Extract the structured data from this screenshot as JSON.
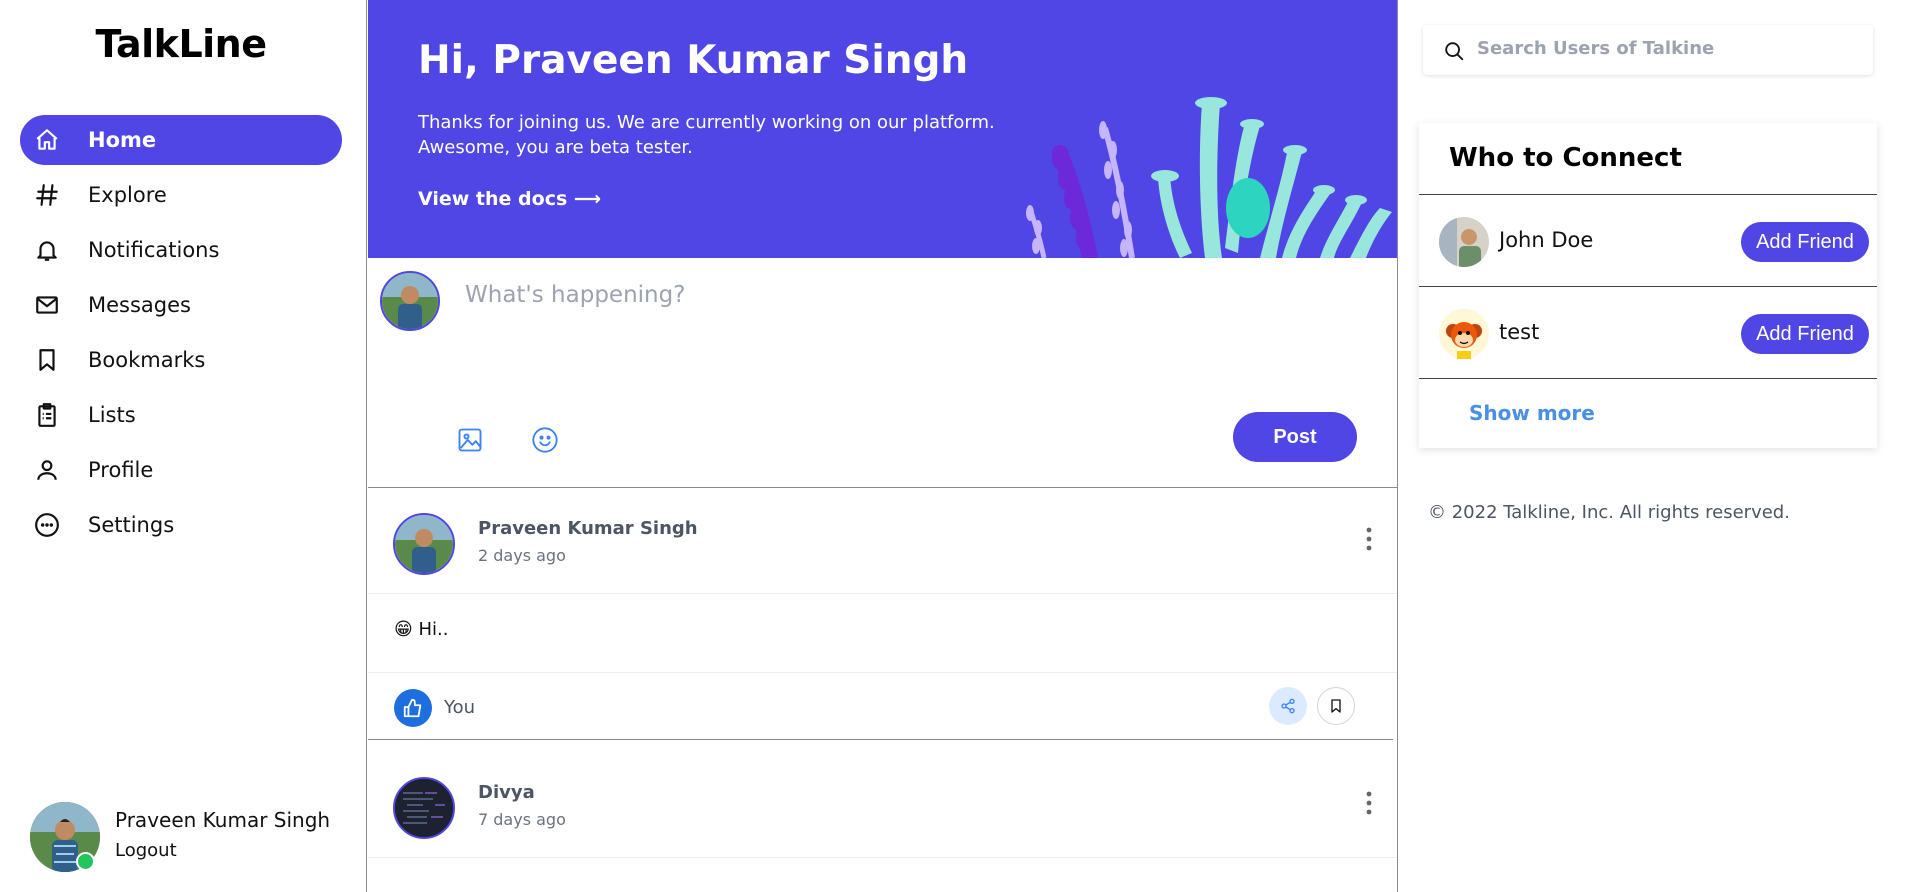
{
  "app": {
    "name": "TalkLine"
  },
  "sidebar": {
    "items": [
      {
        "label": "Home",
        "icon": "home-icon",
        "active": true
      },
      {
        "label": "Explore",
        "icon": "hashtag-icon"
      },
      {
        "label": "Notifications",
        "icon": "bell-icon"
      },
      {
        "label": "Messages",
        "icon": "mail-icon"
      },
      {
        "label": "Bookmarks",
        "icon": "bookmark-icon"
      },
      {
        "label": "Lists",
        "icon": "clipboard-list-icon"
      },
      {
        "label": "Profile",
        "icon": "user-icon"
      },
      {
        "label": "Settings",
        "icon": "more-circle-icon"
      }
    ],
    "user": {
      "name": "Praveen Kumar Singh",
      "logout_label": "Logout",
      "status": "online"
    }
  },
  "banner": {
    "greeting": "Hi, Praveen Kumar Singh",
    "message": "Thanks for joining us. We are currently working on our platform. Awesome, you are beta tester.",
    "docs_link": "View the docs",
    "arrow": "⟶",
    "background_color": "#4f46e5"
  },
  "composer": {
    "placeholder": "What's happening?",
    "post_label": "Post",
    "tools": [
      "image-icon",
      "emoji-icon"
    ]
  },
  "feed": [
    {
      "author": "Praveen Kumar Singh",
      "time": "2 days ago",
      "content": "😁 Hi..",
      "likes_label": "You"
    },
    {
      "author": "Divya",
      "time": "7 days ago"
    }
  ],
  "search": {
    "placeholder": "Search Users of Talkine"
  },
  "who_to_connect": {
    "title": "Who to Connect",
    "users": [
      {
        "name": "John Doe",
        "action": "Add Friend"
      },
      {
        "name": "test",
        "action": "Add Friend"
      }
    ],
    "show_more": "Show more"
  },
  "footer": {
    "copyright": "© 2022 Talkline, Inc. All rights reserved."
  },
  "colors": {
    "accent": "#4f46e5",
    "link": "#4a90e2",
    "like": "#1d6fe0",
    "online": "#22c55e"
  }
}
